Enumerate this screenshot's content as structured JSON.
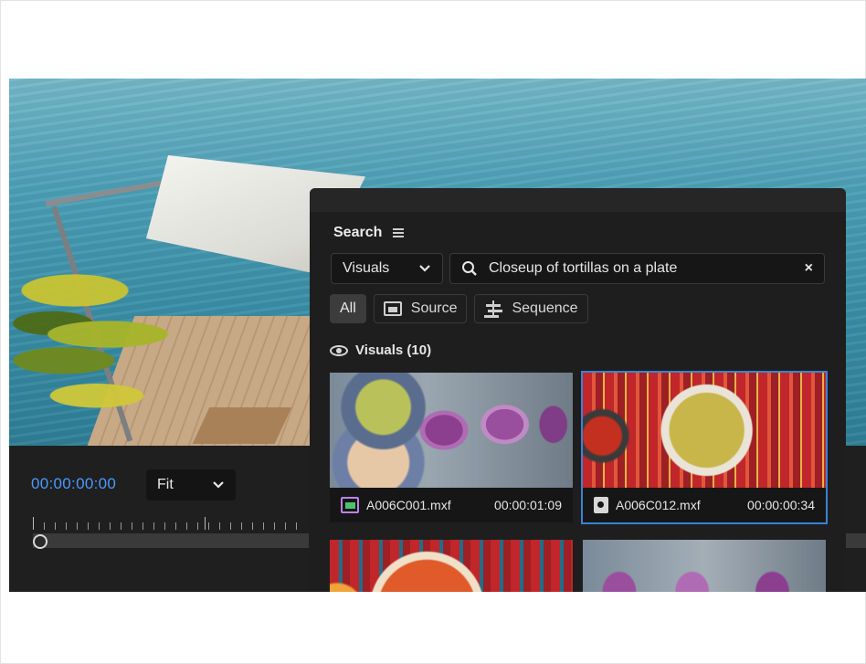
{
  "monitor": {
    "timecode": "00:00:00:00",
    "fit_label": "Fit",
    "chevron": "chevron-down-icon"
  },
  "search_panel": {
    "title": "Search",
    "type_select": "Visuals",
    "query": "Closeup of tortillas on a plate",
    "clear_glyph": "×",
    "filters": [
      {
        "label": "All",
        "active": true
      },
      {
        "label": "Source",
        "icon": "source-icon"
      },
      {
        "label": "Sequence",
        "icon": "sequence-icon"
      }
    ],
    "section_label": "Visuals (10)",
    "results": [
      {
        "name": "A006C001.mxf",
        "duration": "00:00:01:09"
      },
      {
        "name": "A006C012.mxf",
        "duration": "00:00:00:34",
        "selected": true
      },
      {
        "name": "",
        "duration": ""
      },
      {
        "name": "",
        "duration": ""
      }
    ]
  },
  "colors": {
    "accent": "#4a9aff",
    "selection": "#3b82d6",
    "panel_bg": "#1e1e1e"
  }
}
